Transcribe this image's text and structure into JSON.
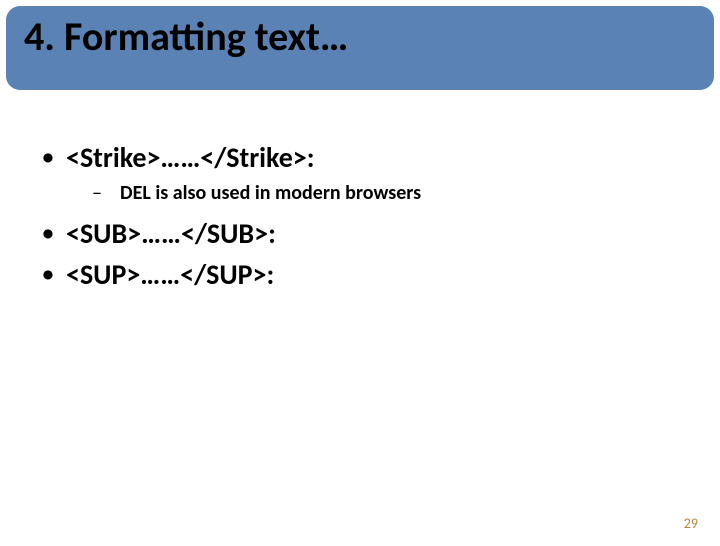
{
  "title": "4. Formatting text…",
  "bullets": {
    "b0": "<Strike>……</Strike>:",
    "b0_sub": "DEL is also used in modern browsers",
    "b1": "<SUB>……</SUB>:",
    "b2": "<SUP>……</SUP>:"
  },
  "page_number": "29"
}
